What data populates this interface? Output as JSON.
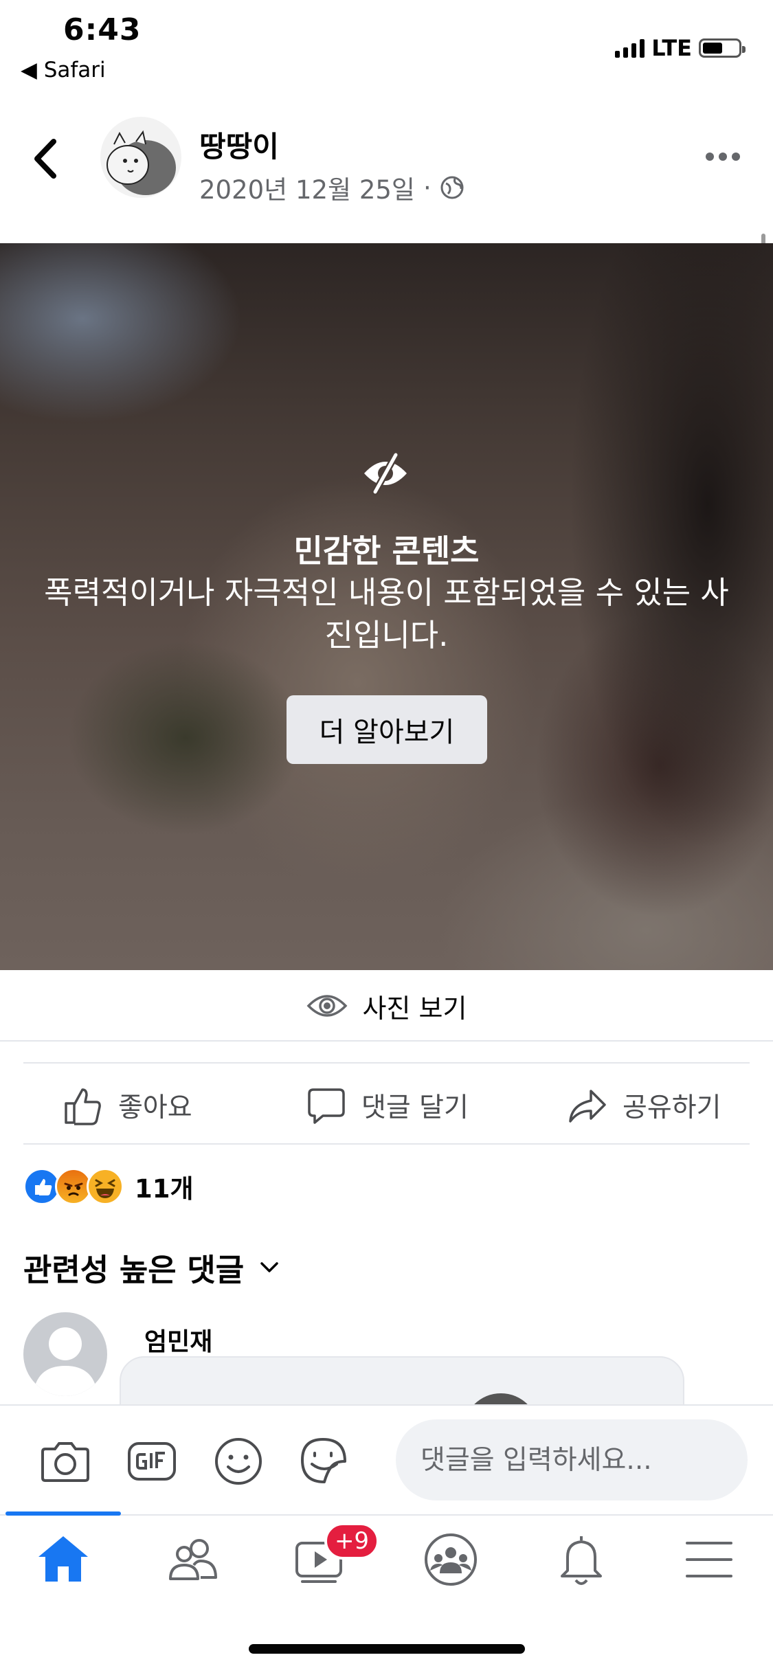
{
  "status_bar": {
    "time": "6:43",
    "back_app": "◀ Safari",
    "network": "LTE",
    "battery_level": 0.55
  },
  "post": {
    "author": "땅땅이",
    "date": "2020년 12월 25일",
    "separator": "·",
    "privacy_icon": "globe-icon"
  },
  "sensitive": {
    "title": "민감한 콘텐츠",
    "description": "폭력적이거나 자극적인 내용이 포함되었을 수 있는 사진입니다.",
    "learn_more": "더 알아보기"
  },
  "view_photo": {
    "label": "사진 보기"
  },
  "actions": {
    "like": "좋아요",
    "comment": "댓글 달기",
    "share": "공유하기"
  },
  "reactions": {
    "icons": [
      "like-icon",
      "angry-icon",
      "haha-icon"
    ],
    "count": "11개"
  },
  "comments": {
    "sort_label": "관련성 높은 댓글",
    "items": [
      {
        "author": "엄민재"
      }
    ]
  },
  "composer": {
    "placeholder": "댓글을 입력하세요..."
  },
  "tabbar": {
    "tabs": [
      "home-icon",
      "friends-icon",
      "watch-icon",
      "groups-icon",
      "notifications-icon",
      "menu-icon"
    ],
    "watch_badge": "+9"
  },
  "colors": {
    "accent": "#1877f2",
    "badge": "#e41e3f",
    "secondary_text": "#65676b"
  }
}
